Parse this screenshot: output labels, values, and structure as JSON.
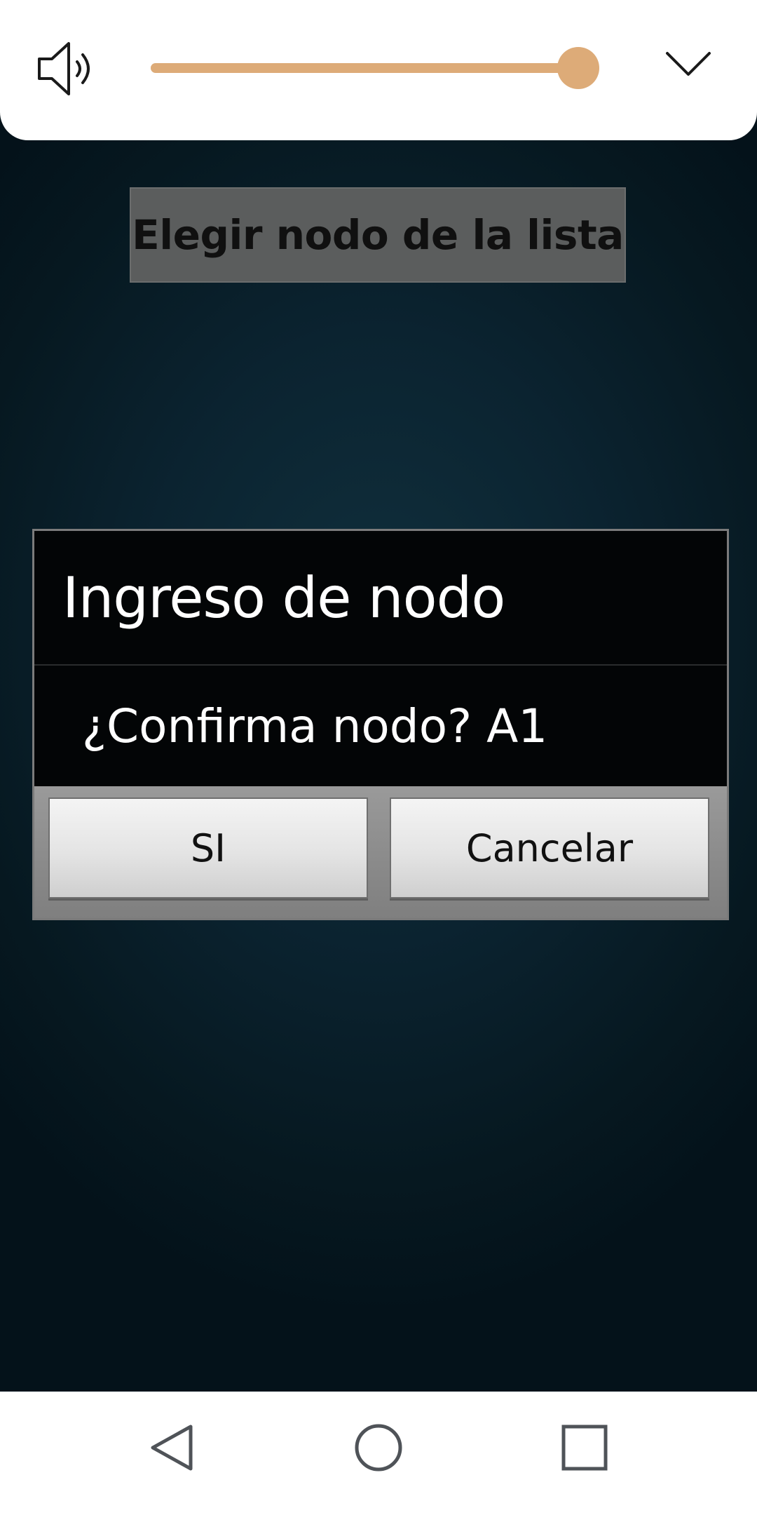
{
  "volume_panel": {
    "speaker_icon": "speaker-volume-icon",
    "volume_level": 1.0,
    "collapse_icon": "chevron-down-icon",
    "accent_color": "#ddab78"
  },
  "main": {
    "choose_button_label": "Elegir nodo de la lista"
  },
  "dialog": {
    "title": "Ingreso de nodo",
    "message": "¿Confirma nodo? A1",
    "yes_label": "SI",
    "cancel_label": "Cancelar"
  },
  "nav_bar": {
    "back_icon": "back-triangle-icon",
    "home_icon": "home-circle-icon",
    "recent_icon": "recent-apps-square-icon"
  }
}
